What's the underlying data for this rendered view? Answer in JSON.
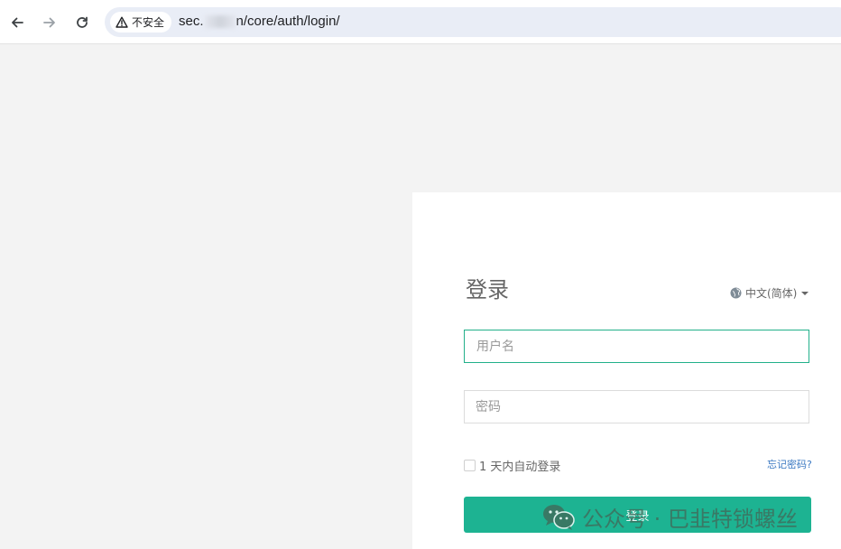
{
  "browser": {
    "security_label": "不安全",
    "url_prefix": "sec.",
    "url_suffix": "n/core/auth/login/"
  },
  "login": {
    "title": "登录",
    "language": "中文(简体)",
    "username_placeholder": "用户名",
    "password_placeholder": "密码",
    "remember_label": "1 天内自动登录",
    "forgot_label": "忘记密码?",
    "submit_label": "登录"
  },
  "watermark": {
    "text": "公众号 · 巴韭特锁螺丝"
  },
  "colors": {
    "accent": "#1db392",
    "focus_border": "#22b08a",
    "link": "#3a78c2",
    "page_bg": "#f3f3f3"
  },
  "icons": [
    "back-arrow-icon",
    "forward-arrow-icon",
    "reload-icon",
    "warning-icon",
    "globe-icon",
    "chevron-down-icon",
    "wechat-icon"
  ]
}
